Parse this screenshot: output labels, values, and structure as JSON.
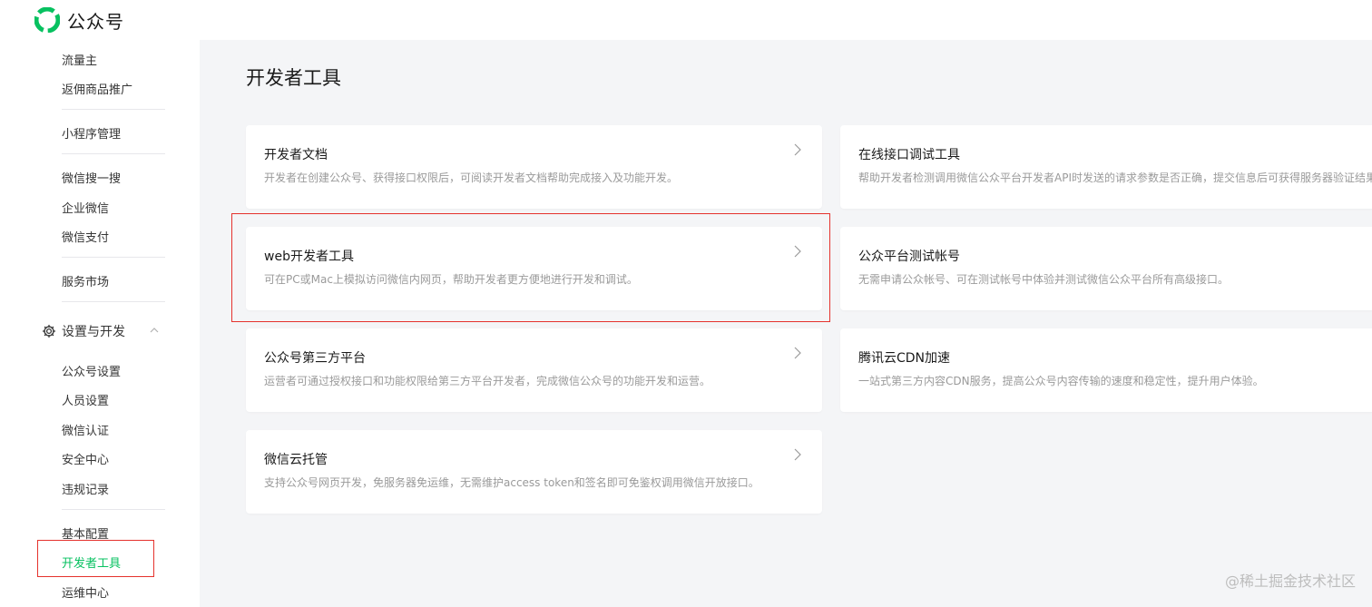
{
  "brand": {
    "name": "公众号",
    "logo_icon": "wechat-official-account-logo-icon"
  },
  "sidebar": {
    "items_top": [
      {
        "label": "流量主"
      },
      {
        "label": "返佣商品推广"
      },
      {
        "label": "小程序管理"
      },
      {
        "label": "微信搜一搜"
      },
      {
        "label": "企业微信"
      },
      {
        "label": "微信支付"
      },
      {
        "label": "服务市场"
      }
    ],
    "section": {
      "label": "设置与开发",
      "icon": "gear-icon",
      "toggle_icon": "chevron-up-icon"
    },
    "items_section": [
      {
        "label": "公众号设置"
      },
      {
        "label": "人员设置"
      },
      {
        "label": "微信认证"
      },
      {
        "label": "安全中心"
      },
      {
        "label": "违规记录"
      },
      {
        "label": "基本配置"
      },
      {
        "label": "开发者工具",
        "active": true
      },
      {
        "label": "运维中心"
      }
    ]
  },
  "main": {
    "title": "开发者工具",
    "cards": [
      {
        "title": "开发者文档",
        "desc": "开发者在创建公众号、获得接口权限后，可阅读开发者文档帮助完成接入及功能开发。"
      },
      {
        "title": "在线接口调试工具",
        "desc": "帮助开发者检测调用微信公众平台开发者API时发送的请求参数是否正确，提交信息后可获得服务器验证结果。"
      },
      {
        "title": "web开发者工具",
        "desc": "可在PC或Mac上模拟访问微信内网页，帮助开发者更方便地进行开发和调试。"
      },
      {
        "title": "公众平台测试帐号",
        "desc": "无需申请公众帐号、可在测试帐号中体验并测试微信公众平台所有高级接口。"
      },
      {
        "title": "公众号第三方平台",
        "desc": "运营者可通过授权接口和功能权限给第三方平台开发者，完成微信公众号的功能开发和运营。"
      },
      {
        "title": "腾讯云CDN加速",
        "desc": "一站式第三方内容CDN服务，提高公众号内容传输的速度和稳定性，提升用户体验。"
      },
      {
        "title": "微信云托管",
        "desc": "支持公众号网页开发，免服务器免运维，无需维护access token和签名即可免鉴权调用微信开放接口。"
      }
    ]
  },
  "watermark": "@稀土掘金技术社区",
  "colors": {
    "accent": "#07c160",
    "highlight": "#e5322d"
  }
}
